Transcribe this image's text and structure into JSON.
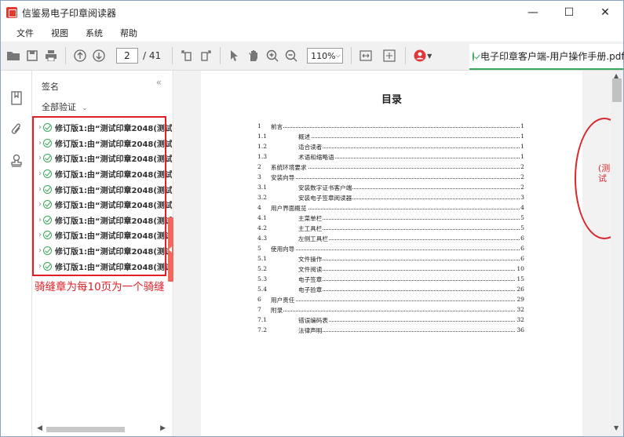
{
  "window": {
    "title": "信鉴易电子印章阅读器",
    "controls": {
      "minimize": "—",
      "maximize": "☐",
      "close": "✕"
    }
  },
  "menu": [
    "文件",
    "视图",
    "系统",
    "帮助"
  ],
  "toolbar": {
    "page_current": "2",
    "page_total": "/ 41",
    "zoom": "110%"
  },
  "doc_tab": {
    "label": "电子印章客户端-用户操作手册.pdf"
  },
  "sidebar": {
    "title": "签名",
    "collapse": "«",
    "verify_all": "全部验证",
    "signatures": [
      "修订版1:由“测试印章2048(测试",
      "修订版1:由“测试印章2048(测试",
      "修订版1:由“测试印章2048(测试",
      "修订版1:由“测试印章2048(测试",
      "修订版1:由“测试印章2048(测试",
      "修订版1:由“测试印章2048(测试",
      "修订版1:由“测试印章2048(测试",
      "修订版1:由“测试印章2048(测试",
      "修订版1:由“测试印章2048(测试",
      "修订版1:由“测试印章2048(测试"
    ]
  },
  "annotation": "骑缝章为每10页为一个骑缝",
  "document": {
    "toc_title": "目录",
    "toc": [
      {
        "num": "1",
        "title": "前言",
        "page": "1",
        "level": 1
      },
      {
        "num": "1.1",
        "title": "概述",
        "page": "1",
        "level": 2
      },
      {
        "num": "1.2",
        "title": "适合读者",
        "page": "1",
        "level": 2
      },
      {
        "num": "1.3",
        "title": "术语和缩略语",
        "page": "1",
        "level": 2
      },
      {
        "num": "2",
        "title": "系统环境要求",
        "page": "2",
        "level": 1
      },
      {
        "num": "3",
        "title": "安装向导",
        "page": "2",
        "level": 1
      },
      {
        "num": "3.1",
        "title": "安装数字证书客户端",
        "page": "2",
        "level": 2
      },
      {
        "num": "3.2",
        "title": "安装电子签章阅读器",
        "page": "3",
        "level": 2
      },
      {
        "num": "4",
        "title": "用户界面概览",
        "page": "4",
        "level": 1
      },
      {
        "num": "4.1",
        "title": "主菜单栏",
        "page": "5",
        "level": 2
      },
      {
        "num": "4.2",
        "title": "主工具栏",
        "page": "5",
        "level": 2
      },
      {
        "num": "4.3",
        "title": "左侧工具栏",
        "page": "6",
        "level": 2
      },
      {
        "num": "5",
        "title": "使用向导",
        "page": "6",
        "level": 1
      },
      {
        "num": "5.1",
        "title": "文件操作",
        "page": "6",
        "level": 2
      },
      {
        "num": "5.2",
        "title": "文件阅读",
        "page": "10",
        "level": 2
      },
      {
        "num": "5.3",
        "title": "电子签章",
        "page": "15",
        "level": 2
      },
      {
        "num": "5.4",
        "title": "电子验章",
        "page": "26",
        "level": 2
      },
      {
        "num": "6",
        "title": "用户责任",
        "page": "29",
        "level": 1
      },
      {
        "num": "7",
        "title": "附录",
        "page": "32",
        "level": 1
      },
      {
        "num": "7.1",
        "title": "错误编码表",
        "page": "32",
        "level": 2
      },
      {
        "num": "7.2",
        "title": "法律声明",
        "page": "36",
        "level": 2
      }
    ],
    "stamp_text": "(测试"
  }
}
